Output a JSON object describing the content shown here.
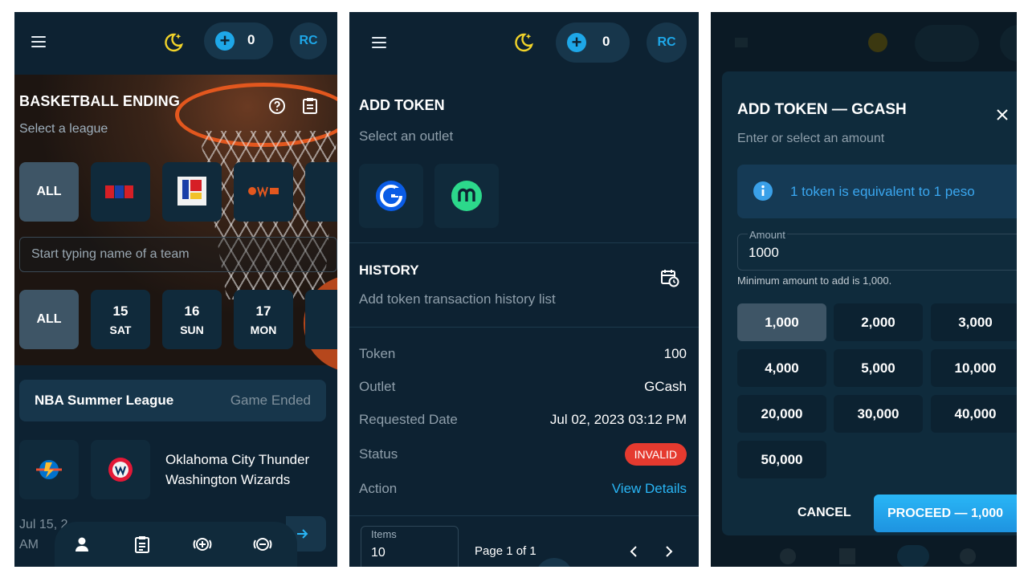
{
  "topbar": {
    "token_count": "0",
    "avatar_initials": "RC"
  },
  "screen1": {
    "title": "BASKETBALL ENDING",
    "subtitle": "Select a league",
    "league_tiles": [
      {
        "label": "ALL"
      },
      {
        "label": "PBA"
      },
      {
        "label": "MPBL"
      },
      {
        "label": "WNBA"
      }
    ],
    "team_search_placeholder": "Start typing name of a team",
    "date_tiles": [
      {
        "day": "ALL",
        "dow": ""
      },
      {
        "day": "15",
        "dow": "SAT"
      },
      {
        "day": "16",
        "dow": "SUN"
      },
      {
        "day": "17",
        "dow": "MON"
      }
    ],
    "league_card": {
      "name": "NBA Summer League",
      "status": "Game Ended"
    },
    "game": {
      "team1": "Oklahoma City Thunder",
      "team2": "Washington Wizards"
    },
    "game_date_line1": "Jul 15, 2",
    "game_date_line2": "AM"
  },
  "screen2": {
    "title": "ADD TOKEN",
    "subtitle": "Select an outlet",
    "outlets": [
      "GCash",
      "Maya"
    ],
    "history_title": "HISTORY",
    "history_subtitle": "Add token transaction history list",
    "rows": [
      {
        "label": "Token",
        "value": "100"
      },
      {
        "label": "Outlet",
        "value": "GCash"
      },
      {
        "label": "Requested Date",
        "value": "Jul 02, 2023 03:12 PM"
      },
      {
        "label": "Status",
        "value": "INVALID"
      },
      {
        "label": "Action",
        "value": "View Details"
      }
    ],
    "items_label": "Items",
    "items_value": "10",
    "page_text": "Page 1 of 1"
  },
  "screen3": {
    "title": "ADD TOKEN — GCASH",
    "subtitle": "Enter or select an amount",
    "info": "1 token is equivalent to 1 peso",
    "amount_label": "Amount",
    "amount_value": "1000",
    "helper": "Minimum amount to add is 1,000.",
    "amounts": [
      "1,000",
      "2,000",
      "3,000",
      "4,000",
      "5,000",
      "10,000",
      "20,000",
      "30,000",
      "40,000",
      "50,000"
    ],
    "cancel": "CANCEL",
    "proceed": "PROCEED — 1,000"
  },
  "colors": {
    "accent": "#1ea7e8",
    "background": "#0d2232",
    "danger": "#e53a2f",
    "moon": "#f2d42a"
  }
}
